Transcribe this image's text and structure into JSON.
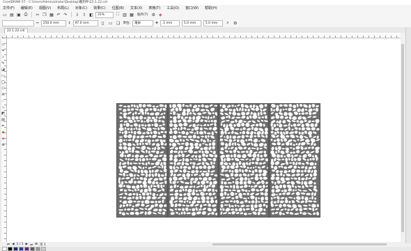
{
  "window": {
    "title": "CorelDRAW X7 - C:\\Users\\Administrator\\Desktop\\雕刻件\\22.1.22.cdr"
  },
  "menu": {
    "items": [
      "文件(F)",
      "编辑(E)",
      "视图(V)",
      "布局(L)",
      "对象(C)",
      "效果(C)",
      "位图(B)",
      "文本(X)",
      "表格(T)",
      "工具(O)",
      "窗口(W)",
      "帮助(H)"
    ]
  },
  "toolbar": {
    "zoom": "31%",
    "snap_label": "贴齐(T)",
    "icons": [
      "new-icon",
      "open-icon",
      "save-icon",
      "print-icon",
      "cut-icon",
      "copy-icon",
      "paste-icon",
      "undo-icon",
      "redo-icon",
      "import-icon",
      "export-icon",
      "publish-icon",
      "full-screen-icon",
      "rulers-icon",
      "grid-icon",
      "snap-icon",
      "options-icon",
      "app-launcher-icon"
    ]
  },
  "propbar": {
    "width": "250.0 mm",
    "height": "97.0 mm",
    "units_label": "单位:",
    "units": "毫米",
    "nudge": ".1 mm",
    "dup_x": "5.0 mm",
    "dup_y": "5.0 mm"
  },
  "document": {
    "tab": "22.1.22.cdr"
  },
  "pagenav": {
    "page": "1 / 1",
    "page_label": "页 1"
  },
  "colors": {
    "accent": "#f0f0f0",
    "panel_fill": "#6e6e6e",
    "canvas": "#ffffff"
  },
  "palette": [
    "#ffffff",
    "#000000",
    "#1e2a78",
    "#2c3e9e",
    "#6a1f7a",
    "#5c5c5c",
    "#999999",
    "#cccccc"
  ]
}
